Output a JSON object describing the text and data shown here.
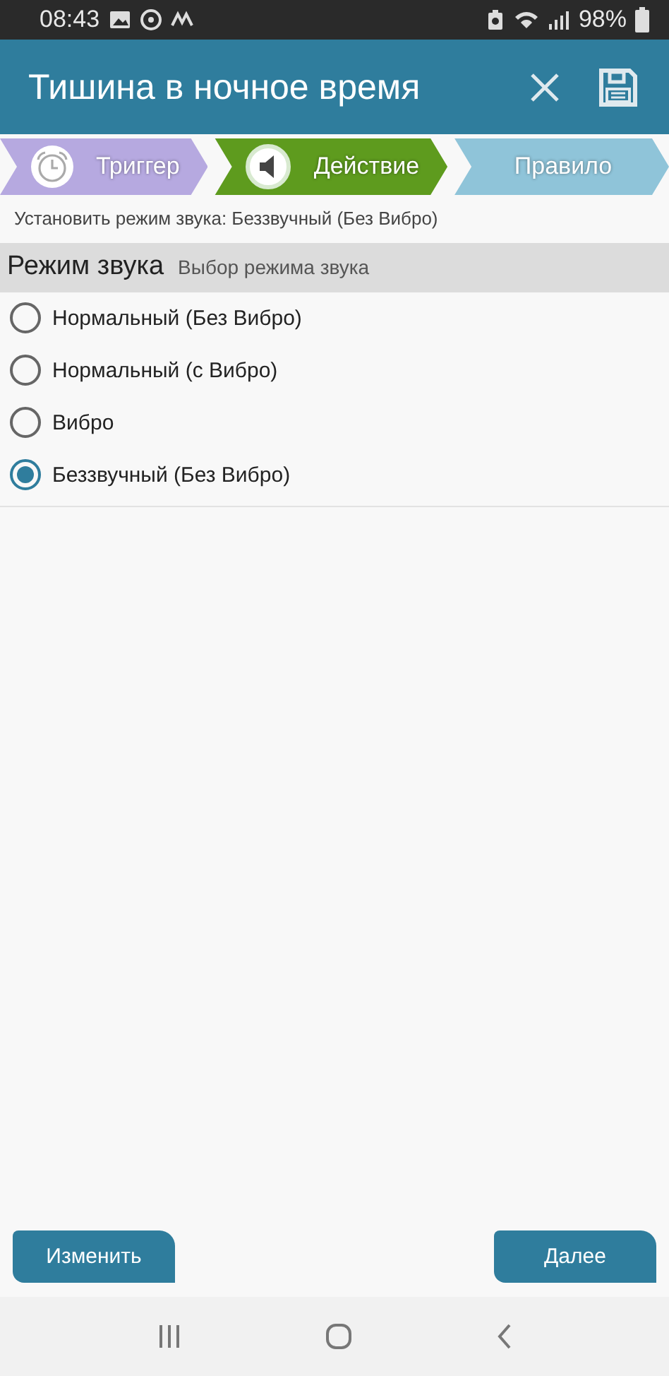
{
  "status_bar": {
    "time": "08:43",
    "battery": "98%"
  },
  "app_bar": {
    "title": "Тишина в ночное время"
  },
  "steps": [
    {
      "label": "Триггер",
      "color": "#b6a9e0",
      "kind": "alarm"
    },
    {
      "label": "Действие",
      "color": "#5e9b1e",
      "kind": "speaker"
    },
    {
      "label": "Правило",
      "color": "#8fc4d9",
      "kind": "none"
    }
  ],
  "summary": "Установить режим звука: Беззвучный (Без Вибро)",
  "section": {
    "title": "Режим звука",
    "subtitle": "Выбор режима звука"
  },
  "options": [
    {
      "label": "Нормальный (Без Вибро)",
      "selected": false
    },
    {
      "label": "Нормальный (с Вибро)",
      "selected": false
    },
    {
      "label": "Вибро",
      "selected": false
    },
    {
      "label": "Беззвучный (Без Вибро)",
      "selected": true
    }
  ],
  "buttons": {
    "left": "Изменить",
    "right": "Далее"
  }
}
